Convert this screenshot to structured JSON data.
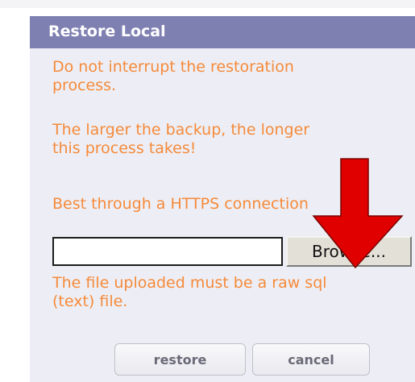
{
  "dialog": {
    "title": "Restore Local",
    "message_1": "Do not interrupt the restoration\nprocess.",
    "message_2": "The larger the backup, the longer\nthis process takes!",
    "message_3": "Best through a HTTPS connection",
    "file_input_value": "",
    "browse_label": "Browse...",
    "note": "The file uploaded must be a raw sql\n(text) file.",
    "restore_label": "restore",
    "cancel_label": "cancel"
  },
  "icons": {
    "annotation_arrow": "red-down-arrow-icon"
  },
  "colors": {
    "header_bg": "#7f80b2",
    "panel_bg": "#edeef5",
    "message_text": "#f58a3a",
    "arrow": "#e00000"
  }
}
